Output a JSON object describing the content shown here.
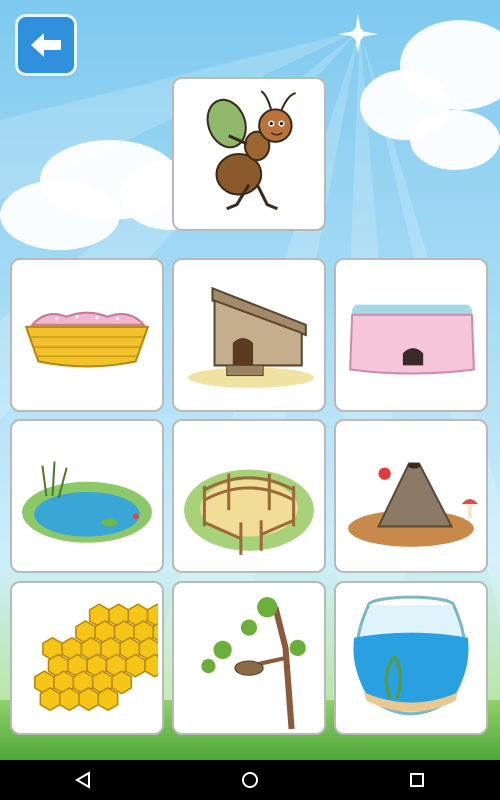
{
  "colors": {
    "sky": "#7ec9ef",
    "grass": "#6cbf4a",
    "back_button": "#2f8fdb",
    "card_border": "#b9b9b9",
    "nav_bar": "#000000"
  },
  "header": {
    "back_button_icon": "arrow-left-icon",
    "prompt_picture": "ant-carrying-sack"
  },
  "answers": [
    {
      "picture": "basket-nest"
    },
    {
      "picture": "wooden-shed"
    },
    {
      "picture": "pink-burrow-house"
    },
    {
      "picture": "pond"
    },
    {
      "picture": "fenced-corral"
    },
    {
      "picture": "anthill"
    },
    {
      "picture": "honeycomb"
    },
    {
      "picture": "bird-nest-in-tree"
    },
    {
      "picture": "fish-bowl"
    }
  ],
  "navigation_bar": {
    "back_icon": "triangle-back-icon",
    "home_icon": "circle-home-icon",
    "recents_icon": "square-recents-icon"
  }
}
